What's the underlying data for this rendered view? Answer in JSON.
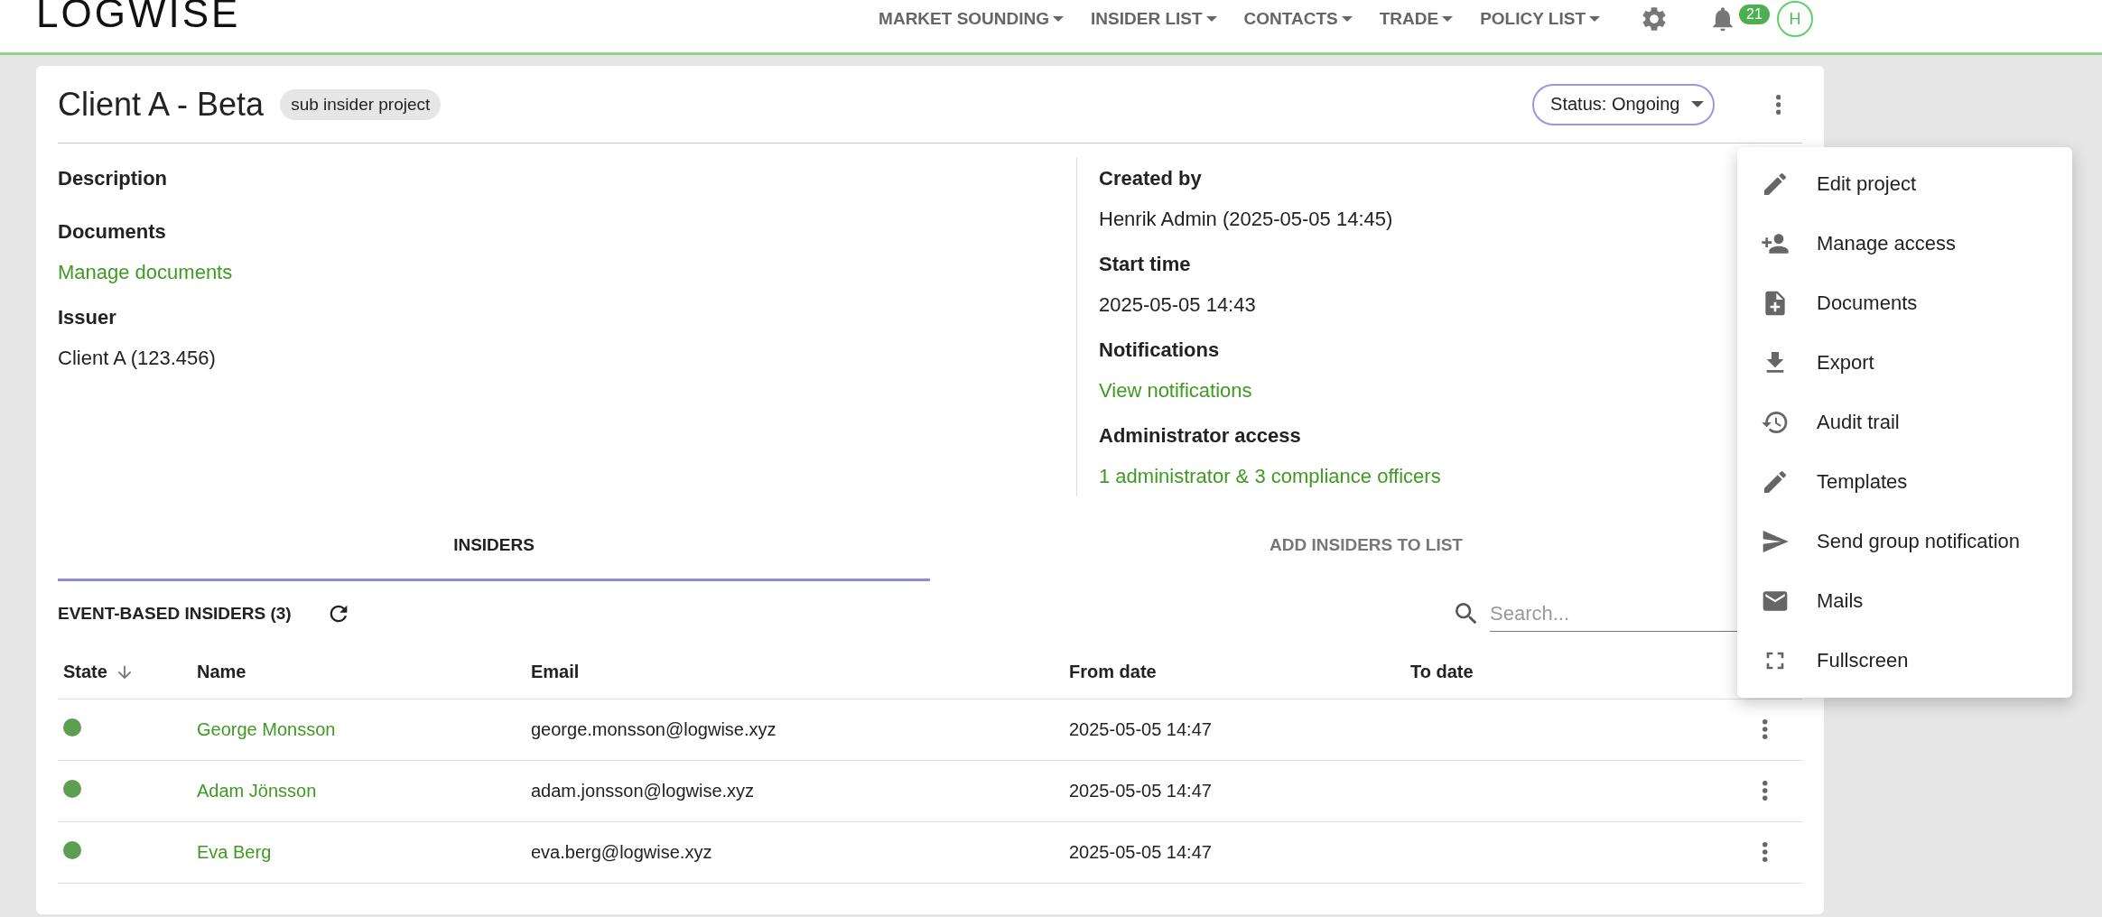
{
  "header": {
    "logo": "LOGWISE",
    "nav": [
      {
        "label": "MARKET SOUNDING"
      },
      {
        "label": "INSIDER LIST"
      },
      {
        "label": "CONTACTS"
      },
      {
        "label": "TRADE"
      },
      {
        "label": "POLICY LIST"
      }
    ],
    "notification_count": "21",
    "avatar": "H"
  },
  "project": {
    "title": "Client A - Beta",
    "chip": "sub insider project",
    "status": "Status: Ongoing"
  },
  "details_left": [
    {
      "label": "Description"
    },
    {
      "label": "Documents",
      "value": "Manage documents",
      "kind": "link"
    },
    {
      "label": "Issuer",
      "value": "Client A (123.456)",
      "kind": "text"
    }
  ],
  "details_right": [
    {
      "label": "Created by",
      "value": "Henrik Admin (2025-05-05 14:45)",
      "kind": "text"
    },
    {
      "label": "Start time",
      "value": "2025-05-05 14:43",
      "kind": "text"
    },
    {
      "label": "Notifications",
      "value": "View notifications",
      "kind": "link"
    },
    {
      "label": "Administrator access",
      "value": "1 administrator & 3 compliance officers",
      "kind": "link"
    }
  ],
  "tabs": [
    {
      "label": "INSIDERS",
      "selected": true
    },
    {
      "label": "ADD INSIDERS TO LIST",
      "selected": false
    }
  ],
  "section": {
    "title": "EVENT-BASED INSIDERS (3)"
  },
  "search": {
    "placeholder": "Search..."
  },
  "table": {
    "columns": [
      {
        "label": "State",
        "sorted": true
      },
      {
        "label": "Name",
        "sorted": false
      },
      {
        "label": "Email",
        "sorted": false
      },
      {
        "label": "From date",
        "sorted": false
      },
      {
        "label": "To date",
        "sorted": false
      }
    ],
    "rows": [
      {
        "color": "#5c9e52",
        "name": "George Monsson",
        "email": "george.monsson@logwise.xyz",
        "from_date": "2025-05-05 14:47"
      },
      {
        "color": "#5c9e52",
        "name": "Adam Jönsson",
        "email": "adam.jonsson@logwise.xyz",
        "from_date": "2025-05-05 14:47"
      },
      {
        "color": "#5c9e52",
        "name": "Eva Berg",
        "email": "eva.berg@logwise.xyz",
        "from_date": "2025-05-05 14:47"
      }
    ]
  },
  "menu": {
    "items": [
      {
        "label": "Edit project",
        "kind": "edit"
      },
      {
        "label": "Manage access",
        "kind": "access"
      },
      {
        "label": "Documents",
        "kind": "documents"
      },
      {
        "label": "Export",
        "kind": "export"
      },
      {
        "label": "Audit trail",
        "kind": "audit"
      },
      {
        "label": "Templates",
        "kind": "edit"
      },
      {
        "label": "Send group notification",
        "kind": "send"
      },
      {
        "label": "Mails",
        "kind": "mail"
      },
      {
        "label": "Fullscreen",
        "kind": "fullscreen"
      }
    ]
  }
}
